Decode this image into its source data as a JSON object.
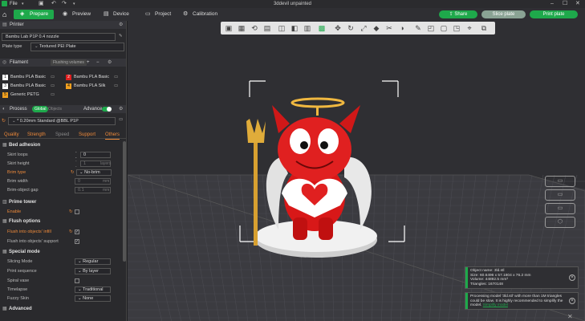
{
  "titlebar": {
    "file_menu": "File",
    "window_title": "3ddevil unpainted"
  },
  "toolbar": {
    "tabs": [
      {
        "label": "Prepare",
        "icon": "cube-icon"
      },
      {
        "label": "Preview",
        "icon": "eye-icon"
      },
      {
        "label": "Device",
        "icon": "printer-icon"
      },
      {
        "label": "Project",
        "icon": "folder-icon"
      },
      {
        "label": "Calibration",
        "icon": "gear-icon"
      }
    ],
    "share_label": "Share",
    "slice_label": "Slice plate",
    "print_label": "Print plate",
    "accent_color": "#1ea94b"
  },
  "printer": {
    "header": "Printer",
    "name": "Bambu Lab P1P 0.4 nozzle",
    "plate_type_label": "Plate type",
    "plate_type_value": "Textured PEI Plate"
  },
  "filament": {
    "header": "Filament",
    "flushing_label": "Flushing volumes",
    "items": [
      {
        "num": "1",
        "name": "Bambu PLA Basic",
        "color": "#ffffff"
      },
      {
        "num": "2",
        "name": "Bambu PLA Basic",
        "color": "#e02020"
      },
      {
        "num": "3",
        "name": "Bambu PLA Basic",
        "color": "#ffffff"
      },
      {
        "num": "4",
        "name": "Bambu PLA Silk",
        "color": "#f0a020"
      },
      {
        "num": "5",
        "name": "Generic PETG",
        "color": "#f0a020"
      }
    ]
  },
  "process": {
    "header": "Process",
    "global_label": "Global",
    "objects_label": "Objects",
    "advance_label": "Advance",
    "preset": "* 0.20mm Standard @BBL P1P",
    "tabs": [
      "Quality",
      "Strength",
      "Speed",
      "Support",
      "Others"
    ]
  },
  "settings": {
    "bed_adhesion": {
      "title": "Bed adhesion",
      "skirt_loops_label": "Skirt loops",
      "skirt_loops_value": "0",
      "skirt_height_label": "Skirt height",
      "skirt_height_value": "1",
      "skirt_height_unit": "layers",
      "brim_type_label": "Brim type",
      "brim_type_value": "No-brim",
      "brim_width_label": "Brim width",
      "brim_width_value": "0",
      "brim_width_unit": "mm",
      "brim_gap_label": "Brim-object gap",
      "brim_gap_value": "0.1",
      "brim_gap_unit": "mm"
    },
    "prime_tower": {
      "title": "Prime tower",
      "enable_label": "Enable"
    },
    "flush_options": {
      "title": "Flush options",
      "infill_label": "Flush into objects' infill",
      "support_label": "Flush into objects' support"
    },
    "special_mode": {
      "title": "Special mode",
      "slicing_mode_label": "Slicing Mode",
      "slicing_mode_value": "Regular",
      "print_sequence_label": "Print sequence",
      "print_sequence_value": "By layer",
      "spiral_vase_label": "Spiral vase",
      "timelapse_label": "Timelapse",
      "timelapse_value": "Traditional",
      "fuzzy_skin_label": "Fuzzy Skin",
      "fuzzy_skin_value": "None"
    },
    "advanced": {
      "title": "Advanced"
    }
  },
  "notifications": {
    "object_info": {
      "name": "Object name: 3ld.stl",
      "size": "Size: 60.6496 x 57.1804 x 76.2 mm",
      "volume": "Volume: 44892.5 mm³",
      "triangles": "Triangles: 1670148"
    },
    "warning": {
      "text": "Processing model '3ld.stl' with more than 1M triangles could be slow. It is highly recommended to simplify the model.",
      "link": "Simplify model"
    }
  }
}
